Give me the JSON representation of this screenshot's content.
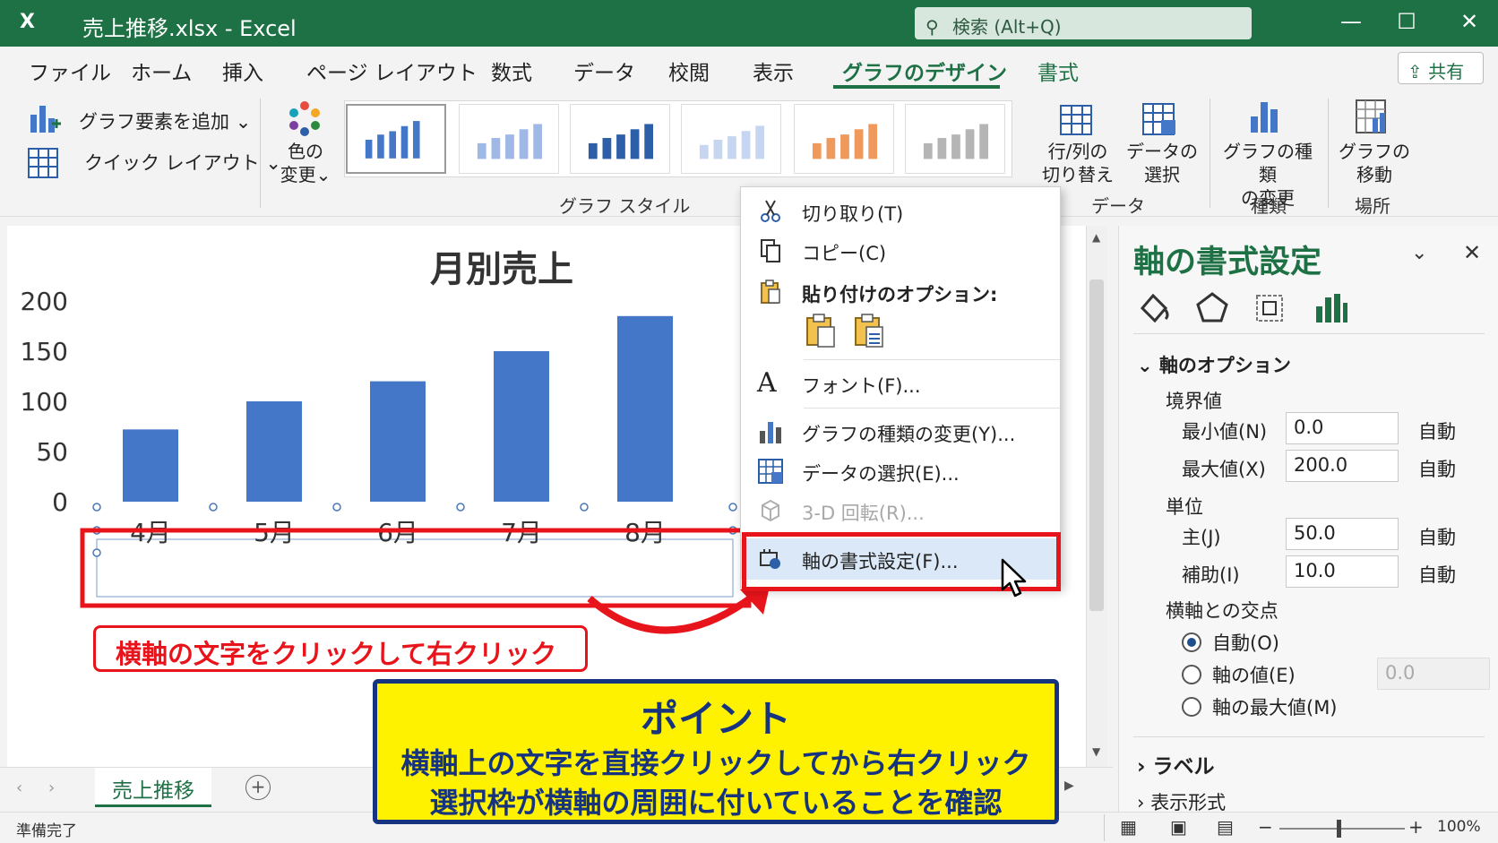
{
  "window": {
    "app_icon": "X",
    "title": "売上推移.xlsx  -  Excel",
    "search_placeholder": "検索 (Alt+Q)",
    "controls": [
      "—",
      "☐",
      "✕"
    ]
  },
  "tabs": [
    {
      "label": "ファイル"
    },
    {
      "label": "ホーム"
    },
    {
      "label": "挿入"
    },
    {
      "label": "ページ レイアウト"
    },
    {
      "label": "数式"
    },
    {
      "label": "データ"
    },
    {
      "label": "校閲"
    },
    {
      "label": "表示"
    },
    {
      "label": "グラフのデザイン",
      "active": true
    },
    {
      "label": "書式"
    }
  ],
  "share_label": "共有",
  "ribbon": {
    "add_element": "グラフ要素を追加",
    "quick_layout": "クイック レイアウト",
    "change_colors": [
      "色の",
      "変更"
    ],
    "styles_group": "グラフ スタイル",
    "switch_rowcol": [
      "行/列の",
      "切り替え"
    ],
    "select_data": [
      "データの",
      "選択"
    ],
    "data_group": "データ",
    "change_type": [
      "グラフの種類",
      "の変更"
    ],
    "type_group": "種類",
    "move_chart": [
      "グラフの",
      "移動"
    ],
    "location_group": "場所",
    "dropdown_arrow": "⌄"
  },
  "chart_data": {
    "type": "bar",
    "title": "月別売上",
    "categories": [
      "4月",
      "5月",
      "6月",
      "7月",
      "8月"
    ],
    "values": [
      72,
      100,
      120,
      150,
      185
    ],
    "ylim": [
      0,
      200
    ],
    "yticks": [
      "0",
      "50",
      "100",
      "150",
      "200"
    ],
    "bar_color": "#4477c8",
    "grid": false
  },
  "context_menu": {
    "cut": "切り取り(T)",
    "copy": "コピー(C)",
    "paste_options": "貼り付けのオプション:",
    "font": "フォント(F)...",
    "change_chart_type": "グラフの種類の変更(Y)...",
    "select_data": "データの選択(E)...",
    "rotate_3d": "3-D 回転(R)...",
    "format_axis": "軸の書式設定(F)...",
    "font_icon_glyph": "A"
  },
  "pane": {
    "title": "軸の書式設定",
    "section_options": "軸のオプション",
    "bounds": "境界値",
    "min_label": "最小値(N)",
    "min_value": "0.0",
    "max_label": "最大値(X)",
    "max_value": "200.0",
    "auto": "自動",
    "units": "単位",
    "major_label": "主(J)",
    "major_value": "50.0",
    "minor_label": "補助(I)",
    "minor_value": "10.0",
    "cross": "横軸との交点",
    "radio_auto": "自動(O)",
    "radio_axis_value": "軸の値(E)",
    "radio_axis_value_input": "0.0",
    "radio_max": "軸の最大値(M)",
    "section_labels": "ラベル",
    "section_number": "表示形式"
  },
  "sheet_tab": "売上推移",
  "status": {
    "ready": "準備完了",
    "zoom": "100%"
  },
  "annotations": {
    "red_note": "横軸の文字をクリックして右クリック",
    "point_title": "ポイント",
    "point_line1": "横軸上の文字を直接クリックしてから右クリック",
    "point_line2": "選択枠が横軸の周囲に付いていることを確認"
  },
  "colors": {
    "excel_green": "#1e7145",
    "highlight_red": "#e8141b",
    "point_yellow": "#fef200",
    "point_navy": "#16337f"
  }
}
